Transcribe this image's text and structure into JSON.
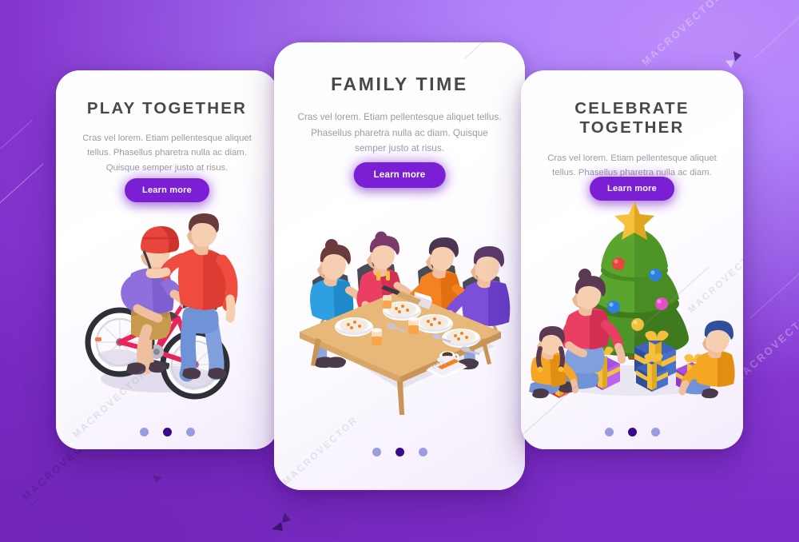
{
  "background": {
    "gradient_from": "#bd8cfb",
    "gradient_to": "#7a2cc6",
    "watermark_text": "MACROVECTOR"
  },
  "theme": {
    "accent": "#7a1fd4",
    "dot_inactive": "#9a9ce0",
    "dot_active": "#3a0a8c",
    "heading_color": "#484848",
    "body_color": "#9b9ba3",
    "card_bg": "#ffffff"
  },
  "cards": [
    {
      "id": "play-together",
      "title": "PLAY TOGETHER",
      "body": "Cras vel lorem. Etiam pellentesque aliquet tellus. Phasellus pharetra nulla ac diam. Quisque semper justo at risus.",
      "button_label": "Learn more",
      "illustration": "father-and-child-on-bicycle",
      "dots": [
        {
          "active": false
        },
        {
          "active": true
        },
        {
          "active": false
        }
      ]
    },
    {
      "id": "family-time",
      "title": "FAMILY TIME",
      "body": "Cras vel lorem. Etiam pellentesque aliquet tellus. Phasellus pharetra nulla ac diam. Quisque semper justo at risus.",
      "button_label": "Learn more",
      "illustration": "family-dining-at-table",
      "dots": [
        {
          "active": false
        },
        {
          "active": true
        },
        {
          "active": false
        }
      ]
    },
    {
      "id": "celebrate-together",
      "title": "CELEBRATE TOGETHER",
      "body": "Cras vel lorem. Etiam pellentesque aliquet tellus. Phasellus pharetra nulla ac diam.",
      "button_label": "Learn more",
      "illustration": "christmas-tree-with-presents",
      "dots": [
        {
          "active": false
        },
        {
          "active": true
        },
        {
          "active": false
        }
      ]
    }
  ]
}
